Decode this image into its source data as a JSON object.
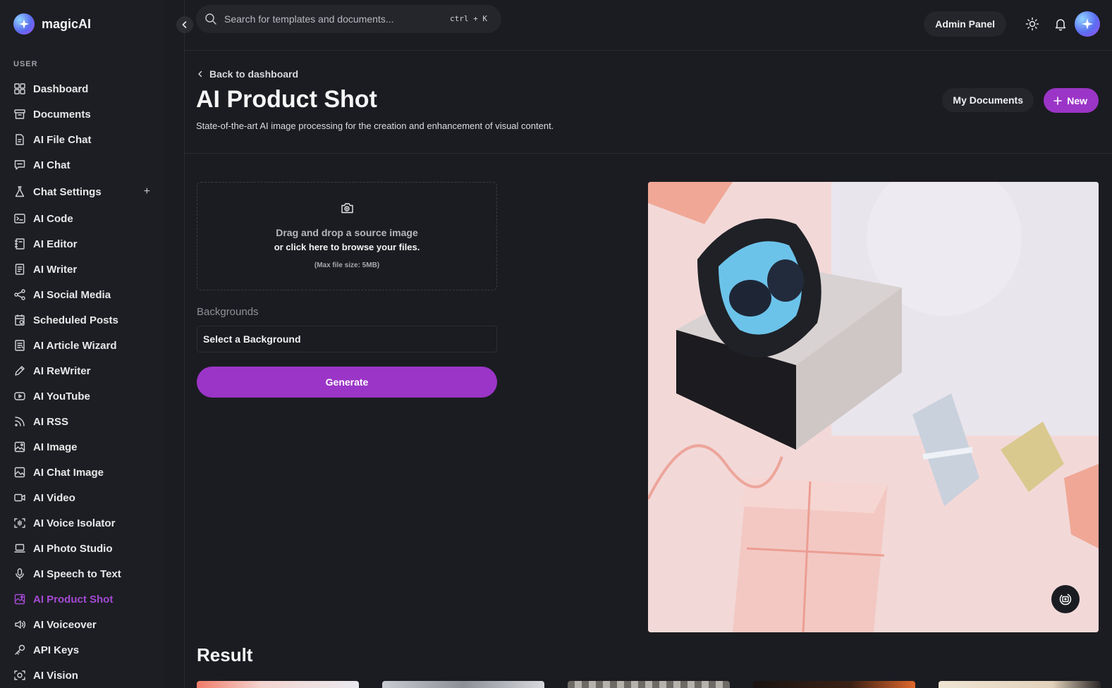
{
  "app": {
    "name": "magicAI"
  },
  "sidebar": {
    "section_label": "USER",
    "items": [
      {
        "label": "Dashboard",
        "icon": "dashboard-icon"
      },
      {
        "label": "Documents",
        "icon": "archive-icon"
      },
      {
        "label": "AI File Chat",
        "icon": "file-chat-icon"
      },
      {
        "label": "AI Chat",
        "icon": "chat-icon"
      },
      {
        "label": "Chat Settings",
        "icon": "flask-icon"
      },
      {
        "label": "AI Code",
        "icon": "terminal-icon"
      },
      {
        "label": "AI Editor",
        "icon": "notebook-icon"
      },
      {
        "label": "AI Writer",
        "icon": "document-icon"
      },
      {
        "label": "AI Social Media",
        "icon": "share-icon"
      },
      {
        "label": "Scheduled Posts",
        "icon": "calendar-doc-icon"
      },
      {
        "label": "AI Article Wizard",
        "icon": "article-icon"
      },
      {
        "label": "AI ReWriter",
        "icon": "pen-icon"
      },
      {
        "label": "AI YouTube",
        "icon": "youtube-icon"
      },
      {
        "label": "AI RSS",
        "icon": "rss-icon"
      },
      {
        "label": "AI Image",
        "icon": "image-icon"
      },
      {
        "label": "AI Chat Image",
        "icon": "chat-image-icon"
      },
      {
        "label": "AI Video",
        "icon": "video-icon"
      },
      {
        "label": "AI Voice Isolator",
        "icon": "voice-isolator-icon"
      },
      {
        "label": "AI Photo Studio",
        "icon": "laptop-icon"
      },
      {
        "label": "AI Speech to Text",
        "icon": "microphone-icon"
      },
      {
        "label": "AI Product Shot",
        "icon": "product-shot-icon"
      },
      {
        "label": "AI Voiceover",
        "icon": "speaker-icon"
      },
      {
        "label": "API Keys",
        "icon": "key-icon"
      },
      {
        "label": "AI Vision",
        "icon": "scan-icon"
      }
    ],
    "active_item": "AI Product Shot",
    "chat_settings_plus": "+"
  },
  "topbar": {
    "search_placeholder": "Search for templates and documents...",
    "shortcut": "ctrl + K",
    "admin_label": "Admin Panel"
  },
  "header": {
    "back_label": "Back to dashboard",
    "title": "AI Product Shot",
    "subtitle": "State-of-the-art AI image processing for the creation and enhancement of visual content.",
    "my_documents_label": "My Documents",
    "new_label": "New"
  },
  "form": {
    "dropzone_line1": "Drag and drop a source image",
    "dropzone_line2": "or click here to browse your files.",
    "dropzone_line3": "(Max file size: 5MB)",
    "backgrounds_label": "Backgrounds",
    "background_select_value": "Select a Background",
    "generate_label": "Generate"
  },
  "result": {
    "title": "Result"
  },
  "colors": {
    "accent": "#9b35c7",
    "active_nav": "#a44ad3",
    "background": "#1b1c21"
  }
}
